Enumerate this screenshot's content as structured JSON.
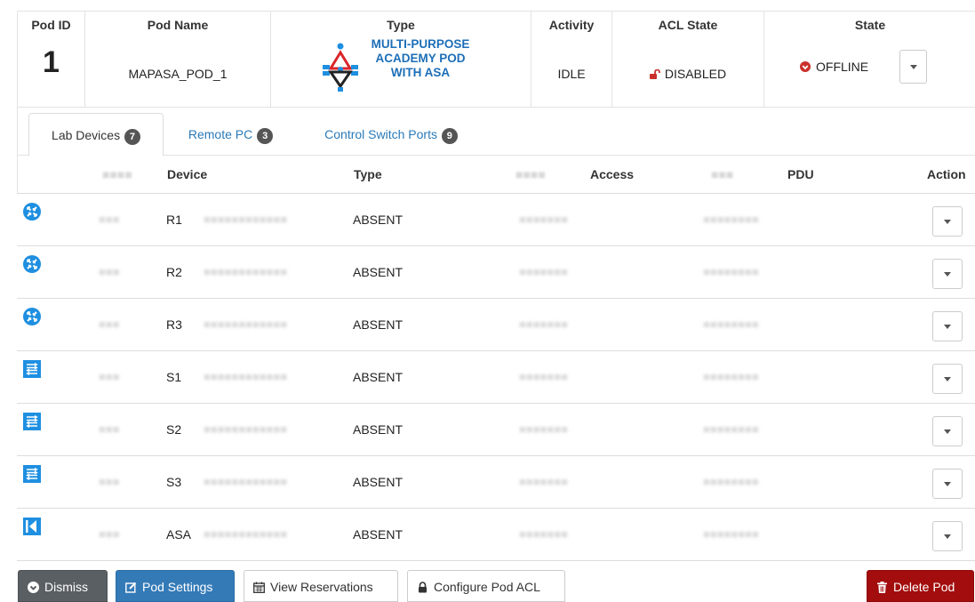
{
  "pod": {
    "headers": {
      "pod_id": "Pod ID",
      "pod_name": "Pod Name",
      "type": "Type",
      "activity": "Activity",
      "acl_state": "ACL State",
      "state": "State"
    },
    "id": "1",
    "name": "MAPASA_POD_1",
    "type_line1": "MULTI-PURPOSE",
    "type_line2": "ACADEMY POD",
    "type_line3": "WITH ASA",
    "activity": "IDLE",
    "acl_state": "DISABLED",
    "state": "OFFLINE"
  },
  "tabs": [
    {
      "label": "Lab Devices",
      "count": "7"
    },
    {
      "label": "Remote PC",
      "count": "3"
    },
    {
      "label": "Control Switch Ports",
      "count": "9"
    }
  ],
  "device_table": {
    "headers": {
      "device": "Device",
      "type": "Type",
      "access": "Access",
      "pdu": "PDU",
      "action": "Action"
    },
    "rows": [
      {
        "icon": "router-icon",
        "device": "R1",
        "type": "ABSENT"
      },
      {
        "icon": "router-icon",
        "device": "R2",
        "type": "ABSENT"
      },
      {
        "icon": "router-icon",
        "device": "R3",
        "type": "ABSENT"
      },
      {
        "icon": "switch-icon",
        "device": "S1",
        "type": "ABSENT"
      },
      {
        "icon": "switch-icon",
        "device": "S2",
        "type": "ABSENT"
      },
      {
        "icon": "switch-icon",
        "device": "S3",
        "type": "ABSENT"
      },
      {
        "icon": "firewall-icon",
        "device": "ASA",
        "type": "ABSENT"
      }
    ]
  },
  "buttons": {
    "dismiss": "Dismiss",
    "pod_settings": "Pod Settings",
    "view_reservations": "View Reservations",
    "configure_acl": "Configure Pod ACL",
    "delete_pod": "Delete Pod"
  },
  "colors": {
    "link_blue": "#2a7ab8",
    "type_blue": "#1d6fb8",
    "device_icon_blue": "#1e8fe1",
    "lock_red": "#c9302c",
    "dismiss_gray": "#5a5f64",
    "settings_blue": "#337ab7",
    "delete_red": "#a30d0d",
    "badge_gray": "#555555"
  }
}
